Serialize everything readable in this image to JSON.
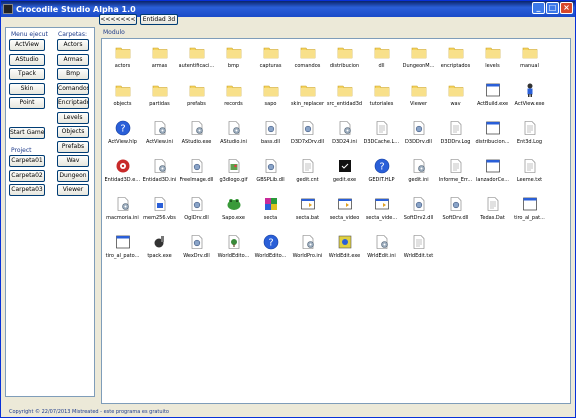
{
  "window": {
    "title": "Crocodile Studio Alpha 1.0"
  },
  "top_buttons": {
    "back_label": "<<<<<<<",
    "entidad_label": "Entidad 3d"
  },
  "menu_ejecut": {
    "header": "Menu ejecut",
    "items": [
      "ActView",
      "AStudio",
      "Tpack",
      "Skin",
      "Point"
    ],
    "start_label": "Start Game"
  },
  "project": {
    "header": "Project",
    "items": [
      "Carpeta01",
      "Carpeta02",
      "Carpeta03"
    ]
  },
  "carpetas": {
    "header": "Carpetas:",
    "items": [
      "Actors",
      "Armas",
      "Bmp",
      "Comandos",
      "Encriptados",
      "Levels",
      "Objects",
      "Prefabs",
      "Wav",
      "Dungeon",
      "Viewer"
    ]
  },
  "file_view": {
    "label": "Modulo",
    "files": [
      {
        "name": "actors",
        "icon": "folder-icon"
      },
      {
        "name": "armas",
        "icon": "folder-icon"
      },
      {
        "name": "autentificacion",
        "icon": "folder-icon"
      },
      {
        "name": "bmp",
        "icon": "folder-icon"
      },
      {
        "name": "capturas",
        "icon": "folder-icon"
      },
      {
        "name": "comandos",
        "icon": "folder-icon"
      },
      {
        "name": "distribucion",
        "icon": "folder-icon"
      },
      {
        "name": "dll",
        "icon": "folder-icon"
      },
      {
        "name": "DungeonM...",
        "icon": "folder-icon"
      },
      {
        "name": "encriptados",
        "icon": "folder-icon"
      },
      {
        "name": "levels",
        "icon": "folder-icon"
      },
      {
        "name": "manual",
        "icon": "folder-icon"
      },
      {
        "name": "objects",
        "icon": "folder-icon"
      },
      {
        "name": "partidas",
        "icon": "folder-icon"
      },
      {
        "name": "prefabs",
        "icon": "folder-icon"
      },
      {
        "name": "records",
        "icon": "folder-icon"
      },
      {
        "name": "sapo",
        "icon": "folder-icon"
      },
      {
        "name": "skin_replacer",
        "icon": "folder-icon"
      },
      {
        "name": "src_entidad3d",
        "icon": "folder-icon"
      },
      {
        "name": "tutoriales",
        "icon": "folder-icon"
      },
      {
        "name": "Viewer",
        "icon": "folder-icon"
      },
      {
        "name": "wav",
        "icon": "folder-icon"
      },
      {
        "name": "ActBuild.exe",
        "icon": "exe-icon"
      },
      {
        "name": "ActView.exe",
        "icon": "actor-exe-icon"
      },
      {
        "name": "ActView.hlp",
        "icon": "help-icon"
      },
      {
        "name": "ActView.ini",
        "icon": "config-icon"
      },
      {
        "name": "AStudio.exe",
        "icon": "config-icon"
      },
      {
        "name": "AStudio.ini",
        "icon": "config-icon"
      },
      {
        "name": "bass.dll",
        "icon": "dll-icon"
      },
      {
        "name": "D3D7xDrv.dll",
        "icon": "dll-icon"
      },
      {
        "name": "D3D24.ini",
        "icon": "config-icon"
      },
      {
        "name": "D3DCache.Log",
        "icon": "text-icon"
      },
      {
        "name": "D3DDrv.dll",
        "icon": "dll-icon"
      },
      {
        "name": "D3DDrv.Log",
        "icon": "text-icon"
      },
      {
        "name": "distribucion...",
        "icon": "exe-icon"
      },
      {
        "name": "Ent3d.Log",
        "icon": "text-icon"
      },
      {
        "name": "Entidad3D.exe",
        "icon": "gear-red-icon"
      },
      {
        "name": "Entidad3D.ini",
        "icon": "config-icon"
      },
      {
        "name": "FreeImage.dll",
        "icon": "dll-icon"
      },
      {
        "name": "g3dlogo.gif",
        "icon": "image-icon"
      },
      {
        "name": "GBSPLib.dll",
        "icon": "dll-icon"
      },
      {
        "name": "gedit.cnt",
        "icon": "text-icon"
      },
      {
        "name": "gedit.exe",
        "icon": "black-exe-icon"
      },
      {
        "name": "GEDIT.HLP",
        "icon": "help-icon"
      },
      {
        "name": "gedit.ini",
        "icon": "config-icon"
      },
      {
        "name": "Informe_Err...",
        "icon": "text-icon"
      },
      {
        "name": "lanzadorCe...",
        "icon": "exe-icon"
      },
      {
        "name": "Leeme.txt",
        "icon": "text-icon"
      },
      {
        "name": "macmoria.ini",
        "icon": "config-icon"
      },
      {
        "name": "mem256.vbs",
        "icon": "script-icon"
      },
      {
        "name": "OglDrv.dll",
        "icon": "dll-icon"
      },
      {
        "name": "Sapo.exe",
        "icon": "frog-icon"
      },
      {
        "name": "secta",
        "icon": "puzzle-icon"
      },
      {
        "name": "secta.bat",
        "icon": "batch-icon"
      },
      {
        "name": "secta_video",
        "icon": "batch-icon"
      },
      {
        "name": "secta_vide...",
        "icon": "batch-icon"
      },
      {
        "name": "SoftDrv2.dll",
        "icon": "dll-icon"
      },
      {
        "name": "SoftDrv.dll",
        "icon": "dll-icon"
      },
      {
        "name": "Tedas.Dat",
        "icon": "text-icon"
      },
      {
        "name": "tiro_al_pat...",
        "icon": "exe-icon"
      },
      {
        "name": "tiro_al_pato...",
        "icon": "exe-icon"
      },
      {
        "name": "tpack.exe",
        "icon": "tpack-icon"
      },
      {
        "name": "WexDrv.dll",
        "icon": "dll-icon"
      },
      {
        "name": "WorldEdito...",
        "icon": "tree-icon"
      },
      {
        "name": "WorldEdito...",
        "icon": "help-icon"
      },
      {
        "name": "WorldPro.ini",
        "icon": "config-icon"
      },
      {
        "name": "WrldEdit.exe",
        "icon": "wrldedit-icon"
      },
      {
        "name": "WrldEdit.ini",
        "icon": "config-icon"
      },
      {
        "name": "WrldEdit.txt",
        "icon": "text-icon"
      }
    ]
  },
  "status": {
    "text": "Copyright © 22/07/2013 Mistreated - este programa es gratuito"
  }
}
